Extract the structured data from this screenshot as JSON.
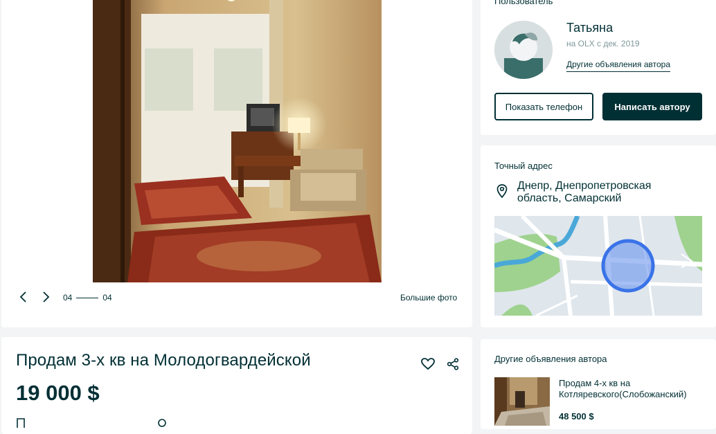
{
  "gallery": {
    "counter_current": "04",
    "counter_total": "04",
    "big_photo_label": "Большие фото",
    "prev_icon": "chevron-left-icon",
    "next_icon": "chevron-right-icon"
  },
  "ad": {
    "title": "Продам 3-х кв на Молодогвардейской",
    "price": "19 000 $",
    "favorite_icon": "heart-icon",
    "share_icon": "share-icon"
  },
  "user": {
    "section_label": "Пользователь",
    "name": "Татьяна",
    "since": "на OLX с дек. 2019",
    "other_ads_link": "Другие объявления автора",
    "show_phone_label": "Показать телефон",
    "message_label": "Написать автору"
  },
  "address": {
    "section_label": "Точный адрес",
    "text": "Днепр, Днепропетровская область, Самарский",
    "pin_icon": "location-pin-icon"
  },
  "other_ads": {
    "section_label": "Другие объявления автора",
    "items": [
      {
        "title": "Продам 4-х кв на Котляревского(Слобожанский)",
        "price": "48 500 $"
      }
    ]
  },
  "colors": {
    "primary": "#002f34",
    "page_bg": "#f2f4f5",
    "map_marker": "#3a73e8"
  }
}
